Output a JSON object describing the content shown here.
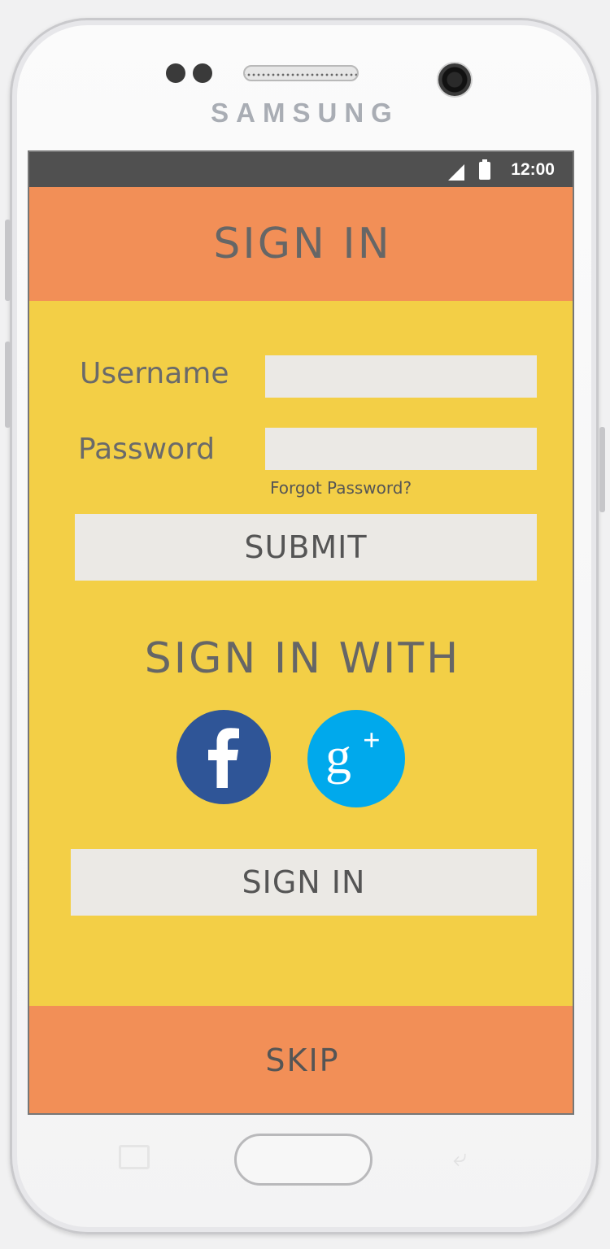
{
  "device": {
    "brand": "SAMSUNG"
  },
  "status_bar": {
    "time": "12:00",
    "icons": [
      "signal-icon",
      "battery-icon"
    ]
  },
  "header": {
    "title": "SIGN IN"
  },
  "form": {
    "username_label": "Username",
    "username_value": "",
    "password_label": "Password",
    "password_value": "",
    "forgot_link": "Forgot Password?",
    "submit_label": "SUBMIT"
  },
  "social": {
    "title": "SIGN IN WITH",
    "providers": [
      {
        "name": "facebook",
        "icon": "facebook-icon",
        "color": "#2f5597"
      },
      {
        "name": "google-plus",
        "icon": "google-plus-icon",
        "color": "#00a9ec"
      }
    ]
  },
  "sign_in_button": "SIGN IN",
  "footer": {
    "skip_label": "SKIP"
  },
  "colors": {
    "header_bg": "#f28f57",
    "content_bg": "#f3cf46",
    "field_bg": "#ebe9e5",
    "status_bar_bg": "#505050"
  }
}
